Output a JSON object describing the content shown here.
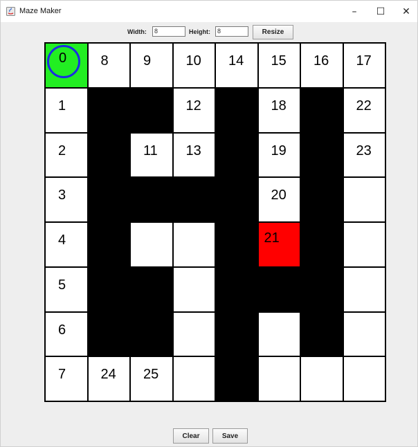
{
  "window": {
    "title": "Maze Maker",
    "controls": {
      "minimize": "–",
      "maximize": "☐",
      "close": "✕"
    }
  },
  "toolbar": {
    "width_label": "Width:",
    "width_value": "8",
    "height_label": "Height:",
    "height_value": "8",
    "resize_label": "Resize"
  },
  "maze": {
    "columns": 8,
    "rows": 8,
    "colors": {
      "path": "#ffffff",
      "wall": "#000000",
      "start": "#22ee22",
      "end": "#ff0000",
      "marker": "#1a2fe0"
    },
    "cells": [
      [
        "start",
        "8",
        "9",
        "10",
        "14",
        "15",
        "16",
        "17"
      ],
      [
        "1",
        "wall",
        "wall",
        "12",
        "wall",
        "18",
        "wall",
        "22"
      ],
      [
        "2",
        "wall",
        "11",
        "13",
        "wall",
        "19",
        "wall",
        "23"
      ],
      [
        "3",
        "wall",
        "wall",
        "wall",
        "wall",
        "20",
        "wall",
        ""
      ],
      [
        "4",
        "wall",
        "",
        "",
        "wall",
        "end",
        "wall",
        ""
      ],
      [
        "5",
        "wall",
        "wall",
        "",
        "wall",
        "wall",
        "wall",
        ""
      ],
      [
        "6",
        "wall",
        "wall",
        "",
        "wall",
        "",
        "wall",
        ""
      ],
      [
        "7",
        "24",
        "25",
        "",
        "wall",
        "",
        "",
        ""
      ]
    ],
    "start_label": "0",
    "end_label": "21"
  },
  "footer": {
    "clear_label": "Clear",
    "save_label": "Save"
  }
}
